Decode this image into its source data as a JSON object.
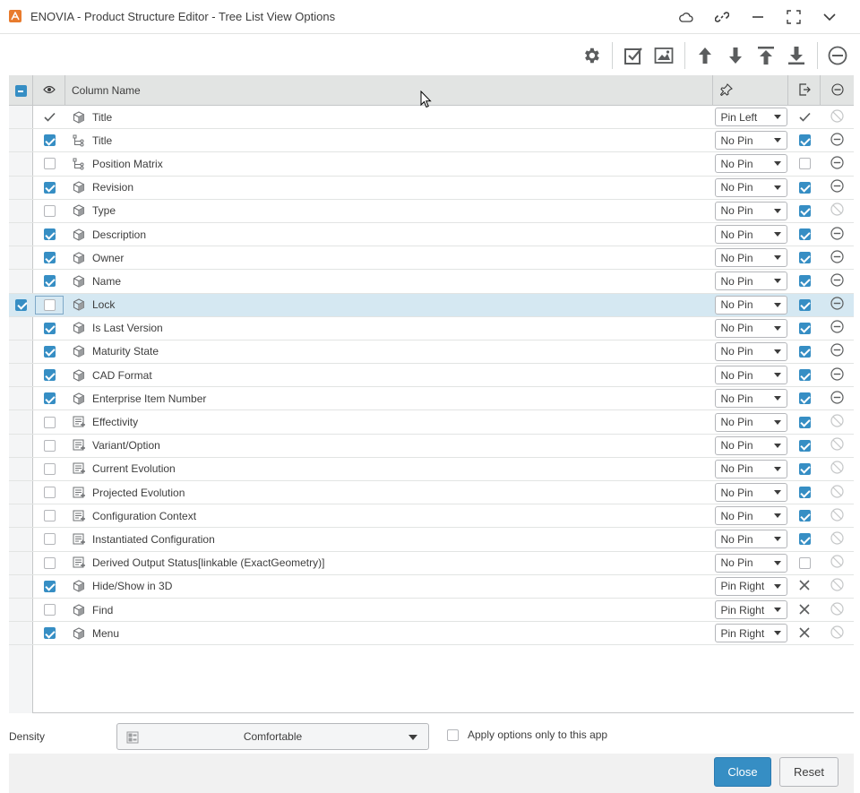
{
  "window": {
    "title": "ENOVIA - Product Structure Editor - Tree List View Options"
  },
  "grid": {
    "header": {
      "column_name": "Column Name"
    },
    "rows": [
      {
        "selected": false,
        "visible": "check-mark",
        "icon": "cube-icon",
        "name": "Title",
        "pin": "Pin Left",
        "exported": "check-mark",
        "removable": false
      },
      {
        "selected": false,
        "visible": "on",
        "icon": "tree-icon",
        "name": "Title",
        "pin": "No Pin",
        "exported": "on",
        "removable": true
      },
      {
        "selected": false,
        "visible": "off",
        "icon": "tree-icon",
        "name": "Position Matrix",
        "pin": "No Pin",
        "exported": "off",
        "removable": true
      },
      {
        "selected": false,
        "visible": "on",
        "icon": "cube-icon",
        "name": "Revision",
        "pin": "No Pin",
        "exported": "on",
        "removable": true
      },
      {
        "selected": false,
        "visible": "off",
        "icon": "cube-icon",
        "name": "Type",
        "pin": "No Pin",
        "exported": "on",
        "removable": false
      },
      {
        "selected": false,
        "visible": "on",
        "icon": "cube-icon",
        "name": "Description",
        "pin": "No Pin",
        "exported": "on",
        "removable": true
      },
      {
        "selected": false,
        "visible": "on",
        "icon": "cube-icon",
        "name": "Owner",
        "pin": "No Pin",
        "exported": "on",
        "removable": true
      },
      {
        "selected": false,
        "visible": "on",
        "icon": "cube-icon",
        "name": "Name",
        "pin": "No Pin",
        "exported": "on",
        "removable": true
      },
      {
        "selected": true,
        "visible": "off",
        "icon": "cube-icon",
        "name": "Lock",
        "pin": "No Pin",
        "exported": "on",
        "removable": true
      },
      {
        "selected": false,
        "visible": "on",
        "icon": "cube-icon",
        "name": "Is Last Version",
        "pin": "No Pin",
        "exported": "on",
        "removable": true
      },
      {
        "selected": false,
        "visible": "on",
        "icon": "cube-icon",
        "name": "Maturity State",
        "pin": "No Pin",
        "exported": "on",
        "removable": true
      },
      {
        "selected": false,
        "visible": "on",
        "icon": "cube-icon",
        "name": "CAD Format",
        "pin": "No Pin",
        "exported": "on",
        "removable": true
      },
      {
        "selected": false,
        "visible": "on",
        "icon": "cube-icon",
        "name": "Enterprise Item Number",
        "pin": "No Pin",
        "exported": "on",
        "removable": true
      },
      {
        "selected": false,
        "visible": "off",
        "icon": "list-icon",
        "name": "Effectivity",
        "pin": "No Pin",
        "exported": "on",
        "removable": false
      },
      {
        "selected": false,
        "visible": "off",
        "icon": "list-icon",
        "name": "Variant/Option",
        "pin": "No Pin",
        "exported": "on",
        "removable": false
      },
      {
        "selected": false,
        "visible": "off",
        "icon": "list-icon",
        "name": "Current Evolution",
        "pin": "No Pin",
        "exported": "on",
        "removable": false
      },
      {
        "selected": false,
        "visible": "off",
        "icon": "list-icon",
        "name": "Projected Evolution",
        "pin": "No Pin",
        "exported": "on",
        "removable": false
      },
      {
        "selected": false,
        "visible": "off",
        "icon": "list-icon",
        "name": "Configuration Context",
        "pin": "No Pin",
        "exported": "on",
        "removable": false
      },
      {
        "selected": false,
        "visible": "off",
        "icon": "list-icon",
        "name": "Instantiated Configuration",
        "pin": "No Pin",
        "exported": "on",
        "removable": false
      },
      {
        "selected": false,
        "visible": "off",
        "icon": "list-icon",
        "name": "Derived Output Status[linkable (ExactGeometry)]",
        "pin": "No Pin",
        "exported": "off",
        "removable": false
      },
      {
        "selected": false,
        "visible": "on",
        "icon": "cube-icon",
        "name": "Hide/Show in 3D",
        "pin": "Pin Right",
        "exported": "x-mark",
        "removable": false
      },
      {
        "selected": false,
        "visible": "off",
        "icon": "cube-icon",
        "name": "Find",
        "pin": "Pin Right",
        "exported": "x-mark",
        "removable": false
      },
      {
        "selected": false,
        "visible": "on",
        "icon": "cube-icon",
        "name": "Menu",
        "pin": "Pin Right",
        "exported": "x-mark",
        "removable": false
      }
    ]
  },
  "footer": {
    "density_label": "Density",
    "density_value": "Comfortable",
    "apply_only_label": "Apply options only to this app",
    "close_label": "Close",
    "reset_label": "Reset"
  },
  "colors": {
    "accent": "#368ec4",
    "selected_row": "#d5e8f2",
    "header_bg": "#e2e4e3",
    "brand_logo": "#e87b2d"
  }
}
